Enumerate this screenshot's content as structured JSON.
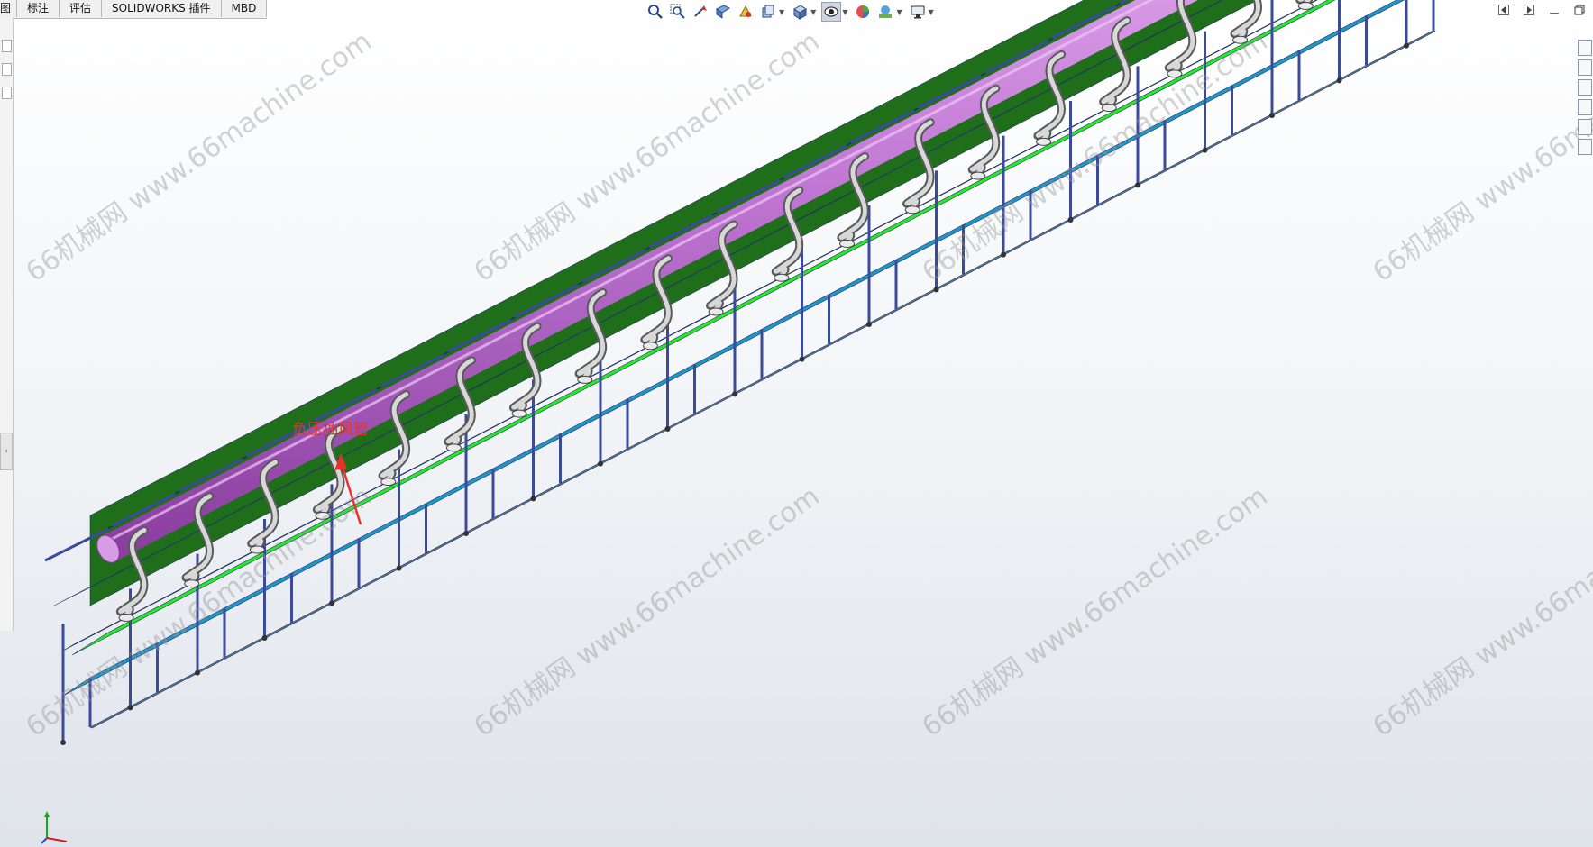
{
  "tabs": [
    {
      "label": "图"
    },
    {
      "label": "标注"
    },
    {
      "label": "评估"
    },
    {
      "label": "SOLIDWORKS 插件"
    },
    {
      "label": "MBD"
    }
  ],
  "view_toolbar": {
    "icons": [
      "zoom-to-fit-icon",
      "zoom-to-area-icon",
      "previous-view-icon",
      "section-view-icon",
      "dynamic-annotation-view-icon",
      "view-orientation-icon",
      "display-style-icon",
      "hide-show-items-icon",
      "edit-appearance-icon",
      "apply-scene-icon",
      "view-settings-icon"
    ]
  },
  "window_controls": [
    "previous-icon",
    "next-icon",
    "minimize-icon",
    "restore-icon"
  ],
  "annotation": {
    "callout_text": "负压抽风管"
  },
  "watermark": {
    "text": "66机械网 www.66machine.com"
  },
  "colors": {
    "pipe": "#c37ad6",
    "frame": "#3c4a9a",
    "panel_green": "#1f6e1a",
    "belt_green": "#28e82a",
    "table_blue": "#1f96c8",
    "rail_brown": "#8a4a32",
    "callout_red": "#e8322c"
  }
}
